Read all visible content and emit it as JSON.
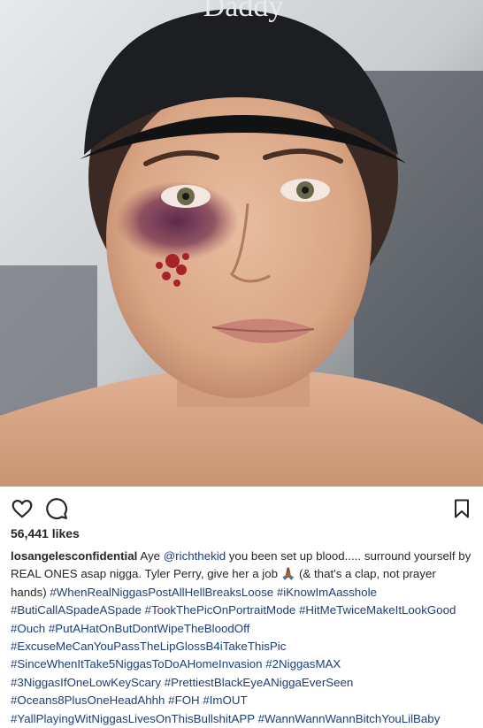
{
  "post": {
    "image_alt": "Photo of a woman wearing a black cap with a bruised eye",
    "cap_text": "Daddy",
    "likes_text": "56,441 likes",
    "username": "losangelesconfidential",
    "caption_part1": " Aye ",
    "mention": "@richthekid",
    "caption_part2": " you been set up blood..... surround yourself by REAL ONES asap nigga. Tyler Perry, give her a job ",
    "caption_emoji": "🙏🏾",
    "caption_part3": " (& that's a clap, not prayer hands) ",
    "hashtags": [
      "#WhenRealNiggasPostAllHellBreaksLoose",
      "#iKnowImAasshole",
      "#ButiCallASpadeASpade",
      "#TookThePicOnPortraitMode",
      "#HitMeTwiceMakeItLookGood",
      "#Ouch",
      "#PutAHatOnButDontWipeTheBloodOff",
      "#ExcuseMeCanYouPassTheLipGlossB4iTakeThisPic",
      "#SinceWhenItTake5NiggasToDoAHomeInvasion",
      "#2NiggasMAX",
      "#3NiggasIfOneLowKeyScary",
      "#PrettiestBlackEyeANiggaEverSeen",
      "#Oceans8PlusOneHeadAhhh",
      "#FOH",
      "#ImOUT",
      "#YallPlayingWitNiggasLivesOnThisBullshitAPP",
      "#WannWannWannBitchYouLilBaby"
    ]
  },
  "icons": {
    "like": "heart-icon",
    "comment": "comment-bubble-icon",
    "save": "bookmark-icon"
  },
  "colors": {
    "hashtag": "#1b3f7a",
    "text": "#262626",
    "background": "#ffffff"
  }
}
